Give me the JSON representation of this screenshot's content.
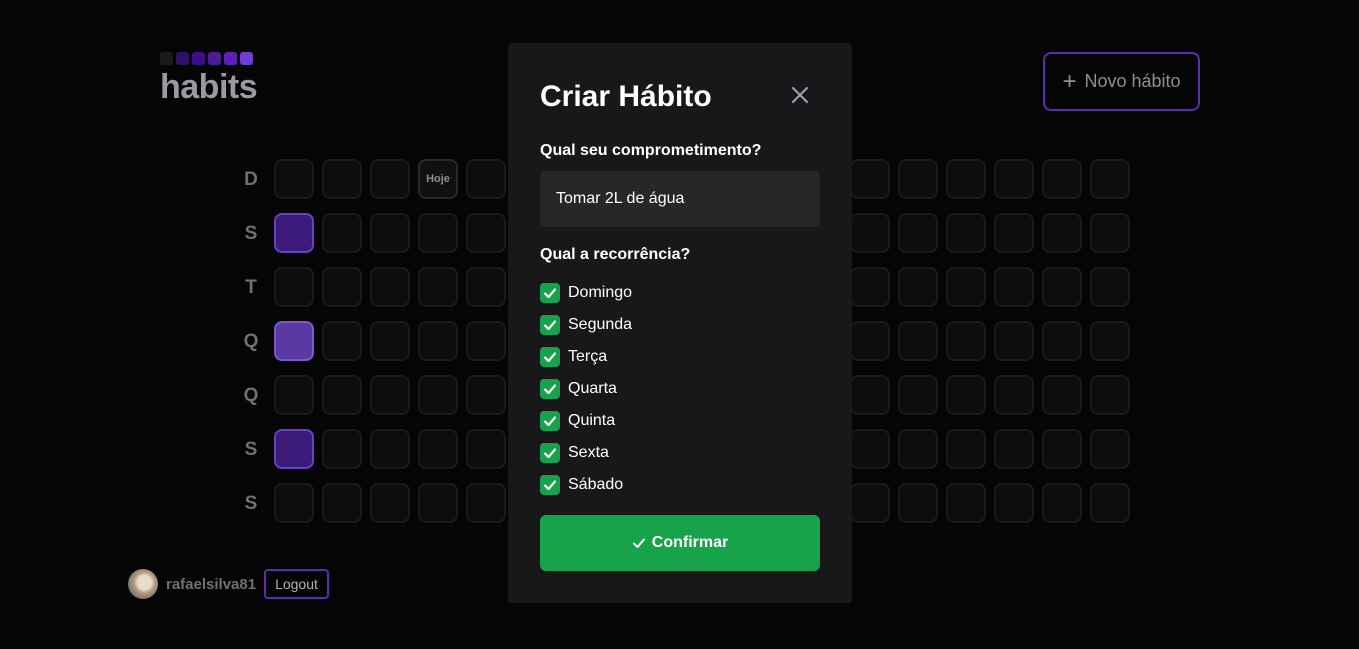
{
  "header": {
    "logo_text": "habits",
    "logo_square_colors": [
      "#1a1a1d",
      "#2e1065",
      "#3b0f8a",
      "#4c1d95",
      "#5b21b6",
      "#6d3ed1"
    ],
    "new_habit_label": "Novo hábito",
    "new_habit_icon": "plus-icon"
  },
  "summary": {
    "weekdays": [
      "D",
      "S",
      "T",
      "Q",
      "Q",
      "S",
      "S"
    ],
    "today_label": "Hoje",
    "completed_levels": {
      "monday_first_week": 1,
      "wednesday_first_week": 2,
      "friday_first_week": 1
    },
    "colors": {
      "level1": "#3b1a78",
      "level2": "#5a3aa2",
      "empty": "#0d0d0f"
    }
  },
  "user": {
    "username": "rafaelsilva81",
    "logout_label": "Logout"
  },
  "modal": {
    "title": "Criar Hábito",
    "close_icon": "close-icon",
    "commitment_label": "Qual seu comprometimento?",
    "commitment_value": "Tomar 2L de água",
    "recurrence_label": "Qual a recorrência?",
    "days": [
      {
        "label": "Domingo",
        "checked": true
      },
      {
        "label": "Segunda",
        "checked": true
      },
      {
        "label": "Terça",
        "checked": true
      },
      {
        "label": "Quarta",
        "checked": true
      },
      {
        "label": "Quinta",
        "checked": true
      },
      {
        "label": "Sexta",
        "checked": true
      },
      {
        "label": "Sábado",
        "checked": true
      }
    ],
    "confirm_label": "Confirmar",
    "confirm_icon": "check-icon",
    "accent_color": "#16a34a"
  }
}
